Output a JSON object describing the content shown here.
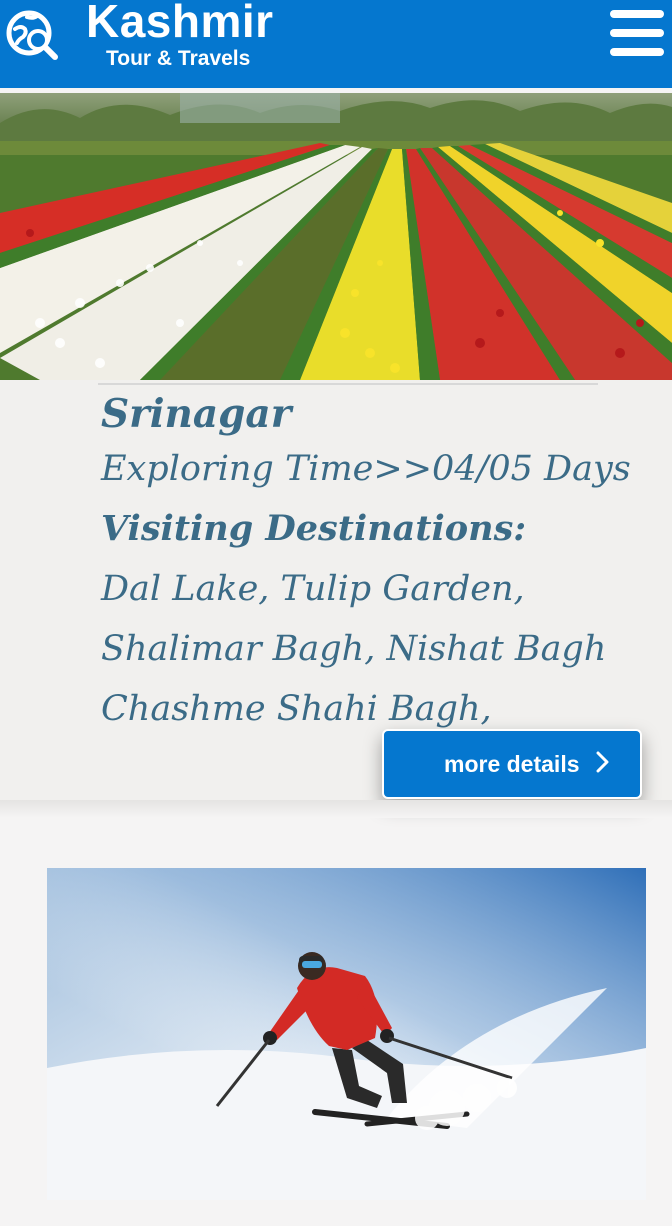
{
  "header": {
    "brand_title": "Kashmir",
    "brand_subtitle": "Tour & Travels",
    "logo_icon": "globe-search-icon",
    "menu_icon": "hamburger-menu-icon",
    "background": "#0577cf"
  },
  "tour": {
    "city": "Srinagar",
    "exploring_time": "Exploring Time>>04/05 Days",
    "visiting_heading": "Visiting Destinations:",
    "destination_lines": [
      "Dal Lake, Tulip Garden,",
      "Shalimar Bagh, Nishat Bagh",
      "Chashme Shahi Bagh,"
    ],
    "more_button_label": "more details",
    "more_button_icon": "chevron-right-icon",
    "text_color": "#3b6b87"
  },
  "images": {
    "hero": "tulip-garden-photo",
    "second": "skier-photo"
  }
}
